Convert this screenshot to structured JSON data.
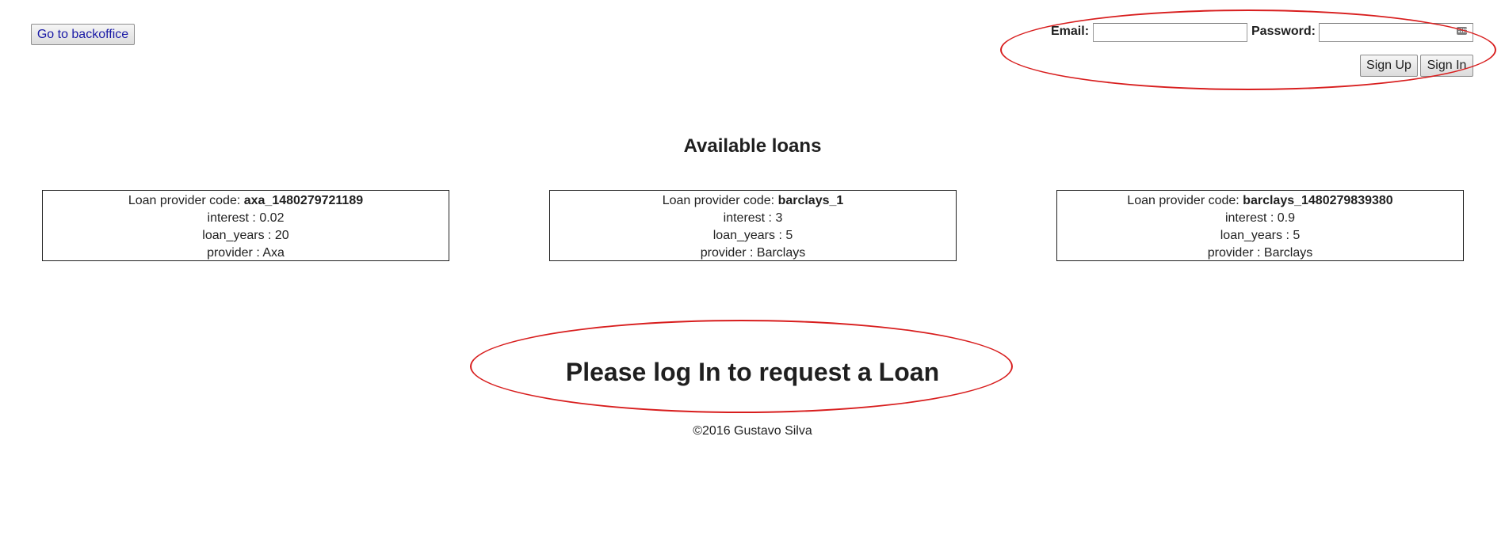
{
  "header": {
    "backoffice_label": "Go to backoffice"
  },
  "login": {
    "email_label": "Email:",
    "email_value": "",
    "password_label": "Password:",
    "password_value": "",
    "signup_label": "Sign Up",
    "signin_label": "Sign In"
  },
  "loans_section": {
    "title": "Available loans",
    "code_label": "Loan provider code: ",
    "interest_label": "interest : ",
    "years_label": "loan_years : ",
    "provider_label": "provider : ",
    "loans": [
      {
        "code": "axa_1480279721189",
        "interest": "0.02",
        "loan_years": "20",
        "provider": "Axa"
      },
      {
        "code": "barclays_1",
        "interest": "3",
        "loan_years": "5",
        "provider": "Barclays"
      },
      {
        "code": "barclays_1480279839380",
        "interest": "0.9",
        "loan_years": "5",
        "provider": "Barclays"
      }
    ]
  },
  "prompt": {
    "text": "Please log In to request a Loan"
  },
  "footer": {
    "text": "©2016 Gustavo Silva"
  },
  "colors": {
    "annotation": "#d81e1e",
    "link_text": "#1a1aa6"
  },
  "icons": {
    "password_field": "keyboard-icon"
  }
}
